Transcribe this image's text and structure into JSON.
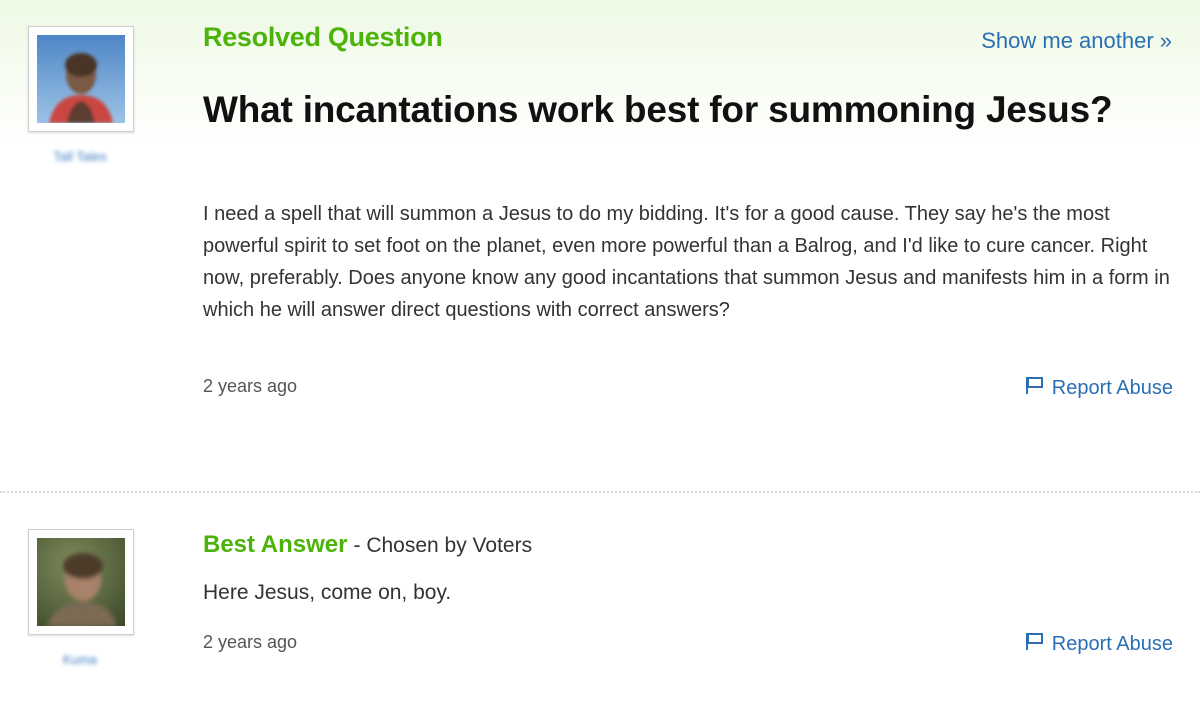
{
  "question": {
    "section_label": "Resolved Question",
    "show_another_label": "Show me another »",
    "title": "What incantations work best for summoning Jesus?",
    "body": "I need a spell that will summon a Jesus to do my bidding. It's for a good cause. They say he's the most powerful spirit to set foot on the planet, even more powerful than a Balrog, and I'd like to cure cancer. Right now, preferably. Does anyone know any good incantations that summon Jesus and manifests him in a form in which he will answer direct questions with correct answers?",
    "timestamp": "2 years ago",
    "report_label": "Report Abuse",
    "asker": {
      "name": "Tall Tales",
      "avatar_icon": "user-photo-icon"
    }
  },
  "answer": {
    "label": "Best Answer",
    "chosen_by": "- Chosen by Voters",
    "body": "Here Jesus, come on, boy.",
    "timestamp": "2 years ago",
    "report_label": "Report Abuse",
    "answerer": {
      "name": "Kuma",
      "avatar_icon": "user-photo-icon"
    }
  },
  "colors": {
    "accent_green": "#4cb30b",
    "link_blue": "#2a6fb5",
    "header_tint": "#eef9e4"
  }
}
